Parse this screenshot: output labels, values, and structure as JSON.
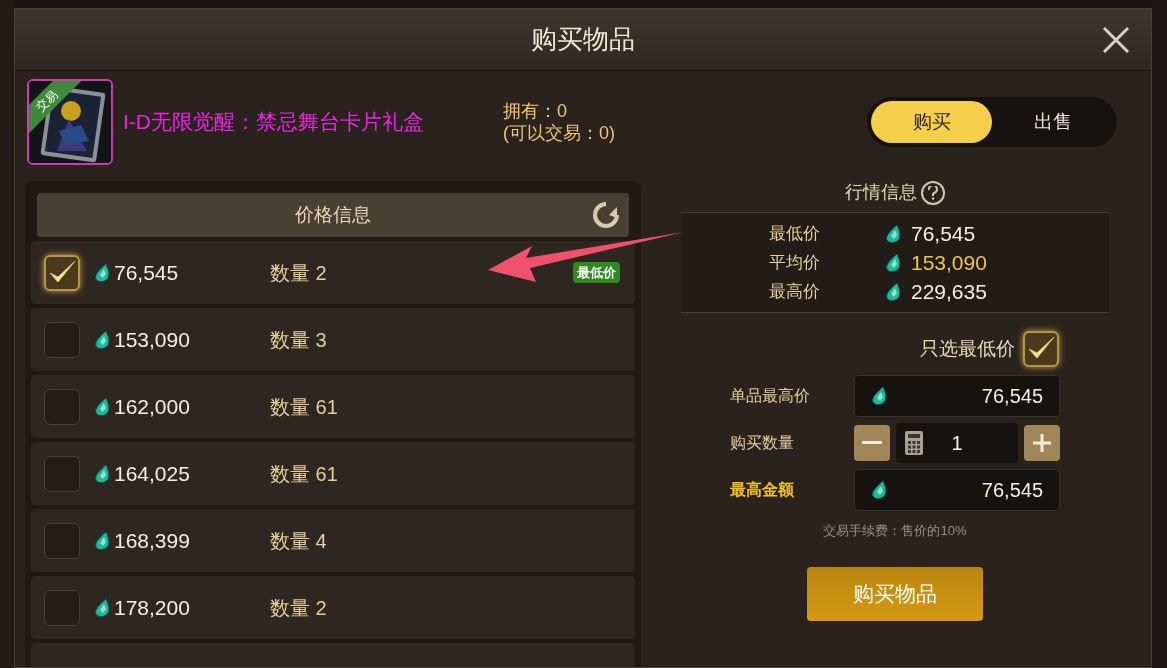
{
  "dialog": {
    "title": "购买物品"
  },
  "item": {
    "name": "I-D无限觉醒：禁忌舞台卡片礼盒",
    "tag": "交易",
    "owned": "拥有：0",
    "tradable": "(可以交易：0)"
  },
  "mode_tabs": [
    {
      "label": "购买",
      "selected": true
    },
    {
      "label": "出售",
      "selected": false
    }
  ],
  "price_list": {
    "title": "价格信息",
    "rows": [
      {
        "price": "76,545",
        "quantity": "数量 2",
        "checked": true,
        "badge": "最低价"
      },
      {
        "price": "153,090",
        "quantity": "数量 3",
        "checked": false
      },
      {
        "price": "162,000",
        "quantity": "数量 61",
        "checked": false
      },
      {
        "price": "164,025",
        "quantity": "数量 61",
        "checked": false
      },
      {
        "price": "168,399",
        "quantity": "数量 4",
        "checked": false
      },
      {
        "price": "178,200",
        "quantity": "数量 2",
        "checked": false
      }
    ]
  },
  "market": {
    "title": "行情信息",
    "stats": [
      {
        "label": "最低价",
        "value": "76,545",
        "highlight": false
      },
      {
        "label": "平均价",
        "value": "153,090",
        "highlight": true
      },
      {
        "label": "最高价",
        "value": "229,635",
        "highlight": false
      }
    ]
  },
  "lowest_only": {
    "label": "只选最低价",
    "checked": true
  },
  "form": {
    "unit_max_label": "单品最高价",
    "unit_max_value": "76,545",
    "quantity_label": "购买数量",
    "quantity_value": "1",
    "total_label": "最高金额",
    "total_value": "76,545",
    "fee_note": "交易手续费：售价的10%"
  },
  "buy_button": "购买物品"
}
